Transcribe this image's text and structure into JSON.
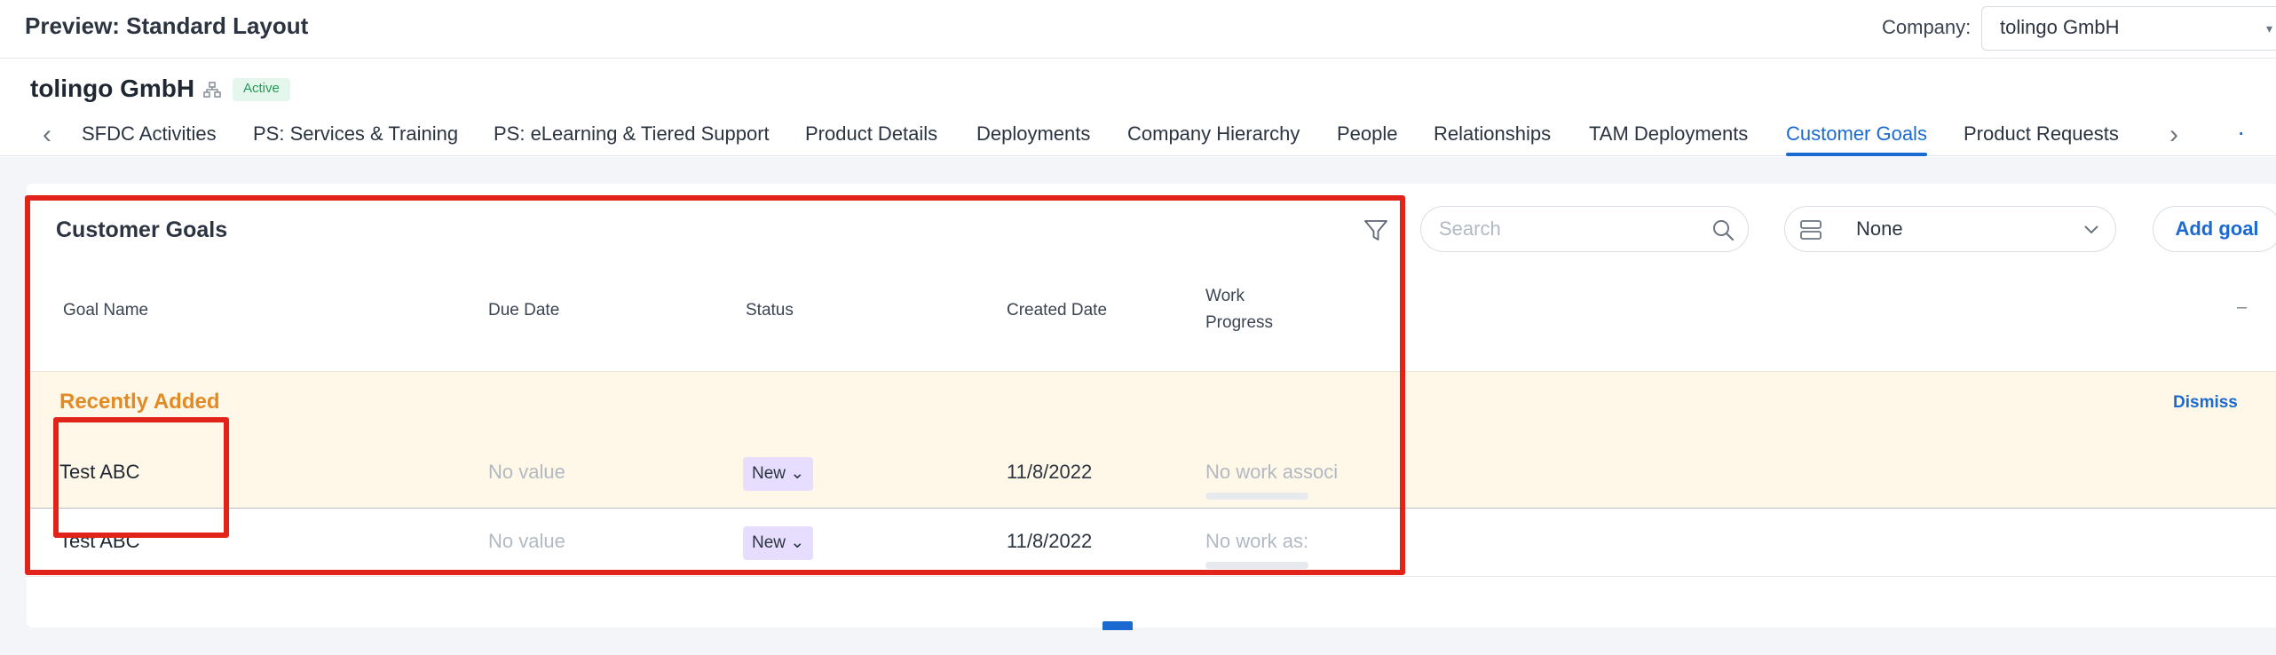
{
  "topbar": {
    "title": "Preview: Standard Layout",
    "company_label": "Company:",
    "company_value": "tolingo GmbH"
  },
  "header": {
    "company_name": "tolingo GmbH",
    "status": "Active"
  },
  "tabs": [
    {
      "label": "SFDC Activities",
      "active": false
    },
    {
      "label": "PS: Services & Training",
      "active": false
    },
    {
      "label": "PS: eLearning & Tiered Support",
      "active": false
    },
    {
      "label": "Product Details",
      "active": false
    },
    {
      "label": "Deployments",
      "active": false
    },
    {
      "label": "Company Hierarchy",
      "active": false
    },
    {
      "label": "People",
      "active": false
    },
    {
      "label": "Relationships",
      "active": false
    },
    {
      "label": "TAM Deployments",
      "active": false
    },
    {
      "label": "Customer Goals",
      "active": true
    },
    {
      "label": "Product Requests",
      "active": false
    }
  ],
  "goals": {
    "title": "Customer Goals",
    "search_placeholder": "Search",
    "group_value": "None",
    "add_label": "Add goal",
    "columns": {
      "goal_name": "Goal Name",
      "due_date": "Due Date",
      "status": "Status",
      "created_date": "Created Date",
      "work_progress_1": "Work",
      "work_progress_2": "Progress"
    },
    "recent_title": "Recently Added",
    "dismiss_label": "Dismiss",
    "rows": [
      {
        "name": "Test ABC",
        "due": "No value",
        "status": "New",
        "created": "11/8/2022",
        "work": "No work associ",
        "progress": 0
      },
      {
        "name": "Test ABC",
        "due": "No value",
        "status": "New",
        "created": "11/8/2022",
        "work": "No work as:",
        "progress": 0
      }
    ]
  },
  "colors": {
    "accent": "#1b6ad1",
    "highlight": "#e2231a",
    "recent": "#e38a24",
    "status_chip": "#e6ddff"
  }
}
